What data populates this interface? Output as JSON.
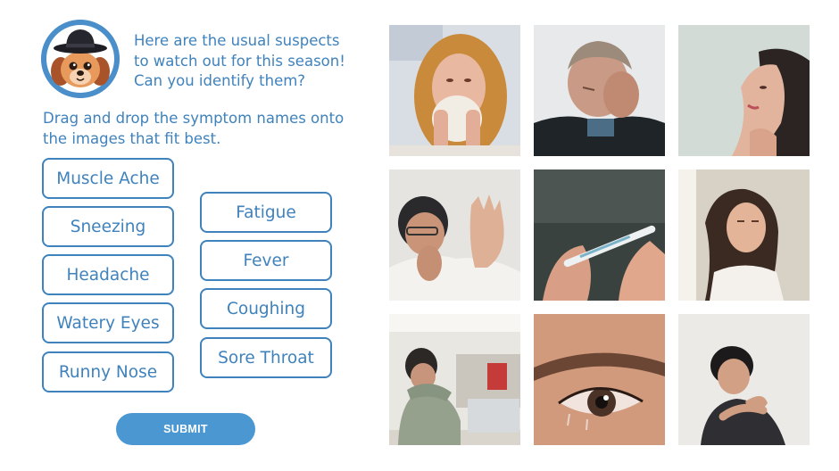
{
  "intro": {
    "lines": [
      "Here are the usual suspects",
      "to watch out for this season!",
      "Can you identify them?"
    ]
  },
  "instructions": {
    "lines": [
      "Drag and drop the symptom names onto",
      "the images that fit best."
    ]
  },
  "chips": [
    {
      "label": "Muscle Ache"
    },
    {
      "label": "Sneezing"
    },
    {
      "label": "Headache"
    },
    {
      "label": "Watery Eyes"
    },
    {
      "label": "Runny Nose"
    },
    {
      "label": "Fatigue"
    },
    {
      "label": "Fever"
    },
    {
      "label": "Coughing"
    },
    {
      "label": "Sore Throat"
    }
  ],
  "submit": {
    "label": "SUBMIT"
  },
  "colors": {
    "accent": "#3f82bc",
    "button": "#4a97d2"
  },
  "images": [
    {
      "icon": "woman-blowing-nose-photo"
    },
    {
      "icon": "man-holding-head-photo"
    },
    {
      "icon": "woman-touching-neck-photo"
    },
    {
      "icon": "man-coughing-hand-up-photo"
    },
    {
      "icon": "thermometer-photo"
    },
    {
      "icon": "woman-tired-head-back-photo"
    },
    {
      "icon": "man-coughing-into-elbow-photo"
    },
    {
      "icon": "watery-eye-closeup-photo"
    },
    {
      "icon": "man-holding-shoulder-photo"
    }
  ]
}
